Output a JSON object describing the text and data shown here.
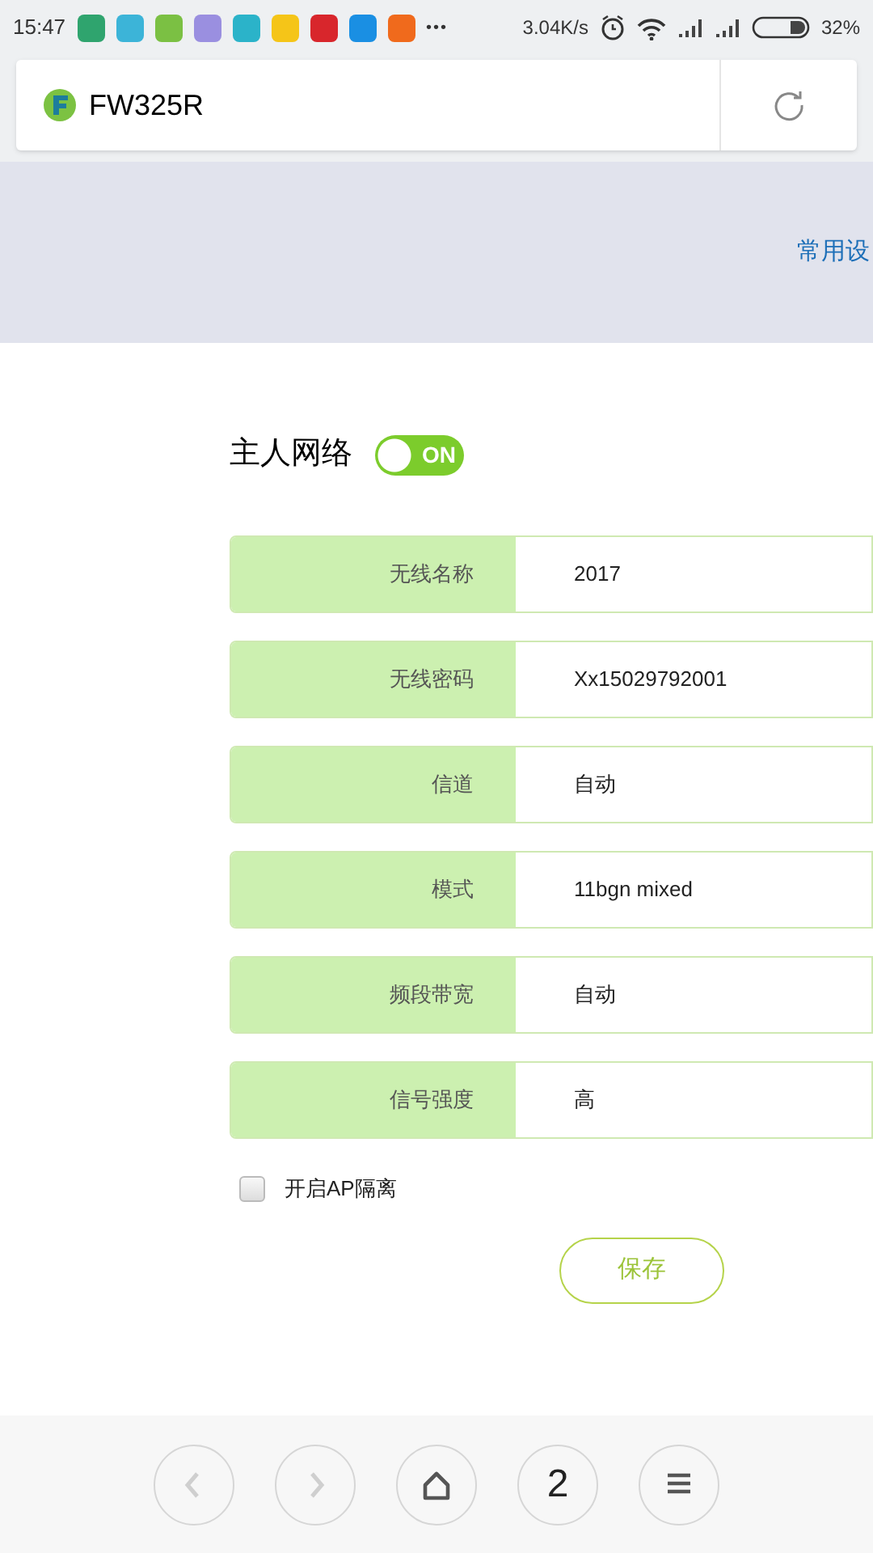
{
  "status_bar": {
    "time": "15:47",
    "notification_icons": [
      {
        "color": "#2fa46e"
      },
      {
        "color": "#3cb4d8"
      },
      {
        "color": "#7bc043"
      },
      {
        "color": "#9a8fe0"
      },
      {
        "color": "#2bb3c9"
      },
      {
        "color": "#f5c518"
      },
      {
        "color": "#d8262c"
      },
      {
        "color": "#1a8fe3"
      },
      {
        "color": "#f06a1c"
      }
    ],
    "more": "•••",
    "speed": "3.04K/s",
    "battery_percent": "32%"
  },
  "address_bar": {
    "title": "FW325R"
  },
  "banner": {
    "link": "常用设"
  },
  "network": {
    "title": "主人网络",
    "toggle": {
      "label": "ON",
      "on": true
    }
  },
  "fields": [
    {
      "label": "无线名称",
      "value": "2017"
    },
    {
      "label": "无线密码",
      "value": "Xx15029792001"
    },
    {
      "label": "信道",
      "value": "自动"
    },
    {
      "label": "模式",
      "value": "11bgn mixed"
    },
    {
      "label": "频段带宽",
      "value": "自动"
    },
    {
      "label": "信号强度",
      "value": "高"
    }
  ],
  "ap_isolation": {
    "label": "开启AP隔离",
    "checked": false
  },
  "save_button": "保存",
  "bottom_nav": [
    {
      "kind": "back",
      "disabled": true
    },
    {
      "kind": "forward",
      "disabled": true
    },
    {
      "kind": "home",
      "disabled": false
    },
    {
      "kind": "tabs",
      "label": "2",
      "disabled": false
    },
    {
      "kind": "menu",
      "disabled": false
    }
  ]
}
